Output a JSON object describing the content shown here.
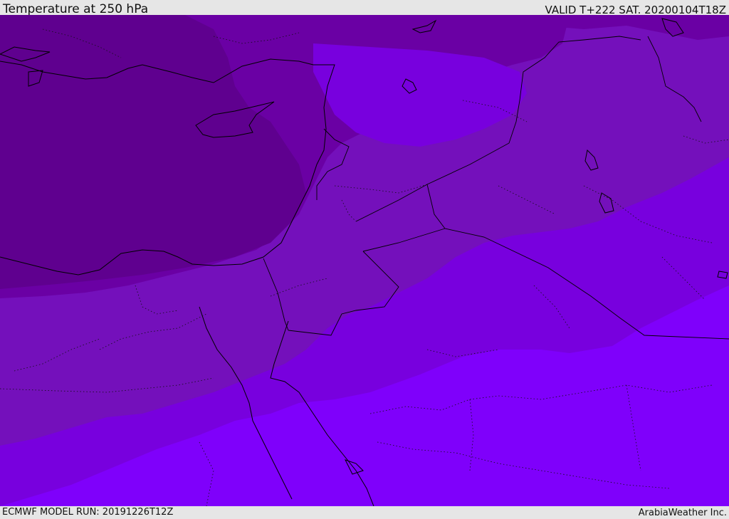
{
  "header": {
    "title": "Temperature at 250 hPa",
    "valid_time": "VALID T+222 SAT. 20200104T18Z"
  },
  "footer": {
    "model_run": "ECMWF MODEL RUN: 20191226T12Z",
    "credit": "ArabiaWeather Inc."
  },
  "map": {
    "variable": "temperature",
    "level": "250 hPa",
    "region": "Eastern Mediterranean / Middle East",
    "color_bands": [
      "#5f008f",
      "#6a00a1",
      "#7410b8",
      "#7a00d4",
      "#7f00f0",
      "#8000ff"
    ]
  }
}
